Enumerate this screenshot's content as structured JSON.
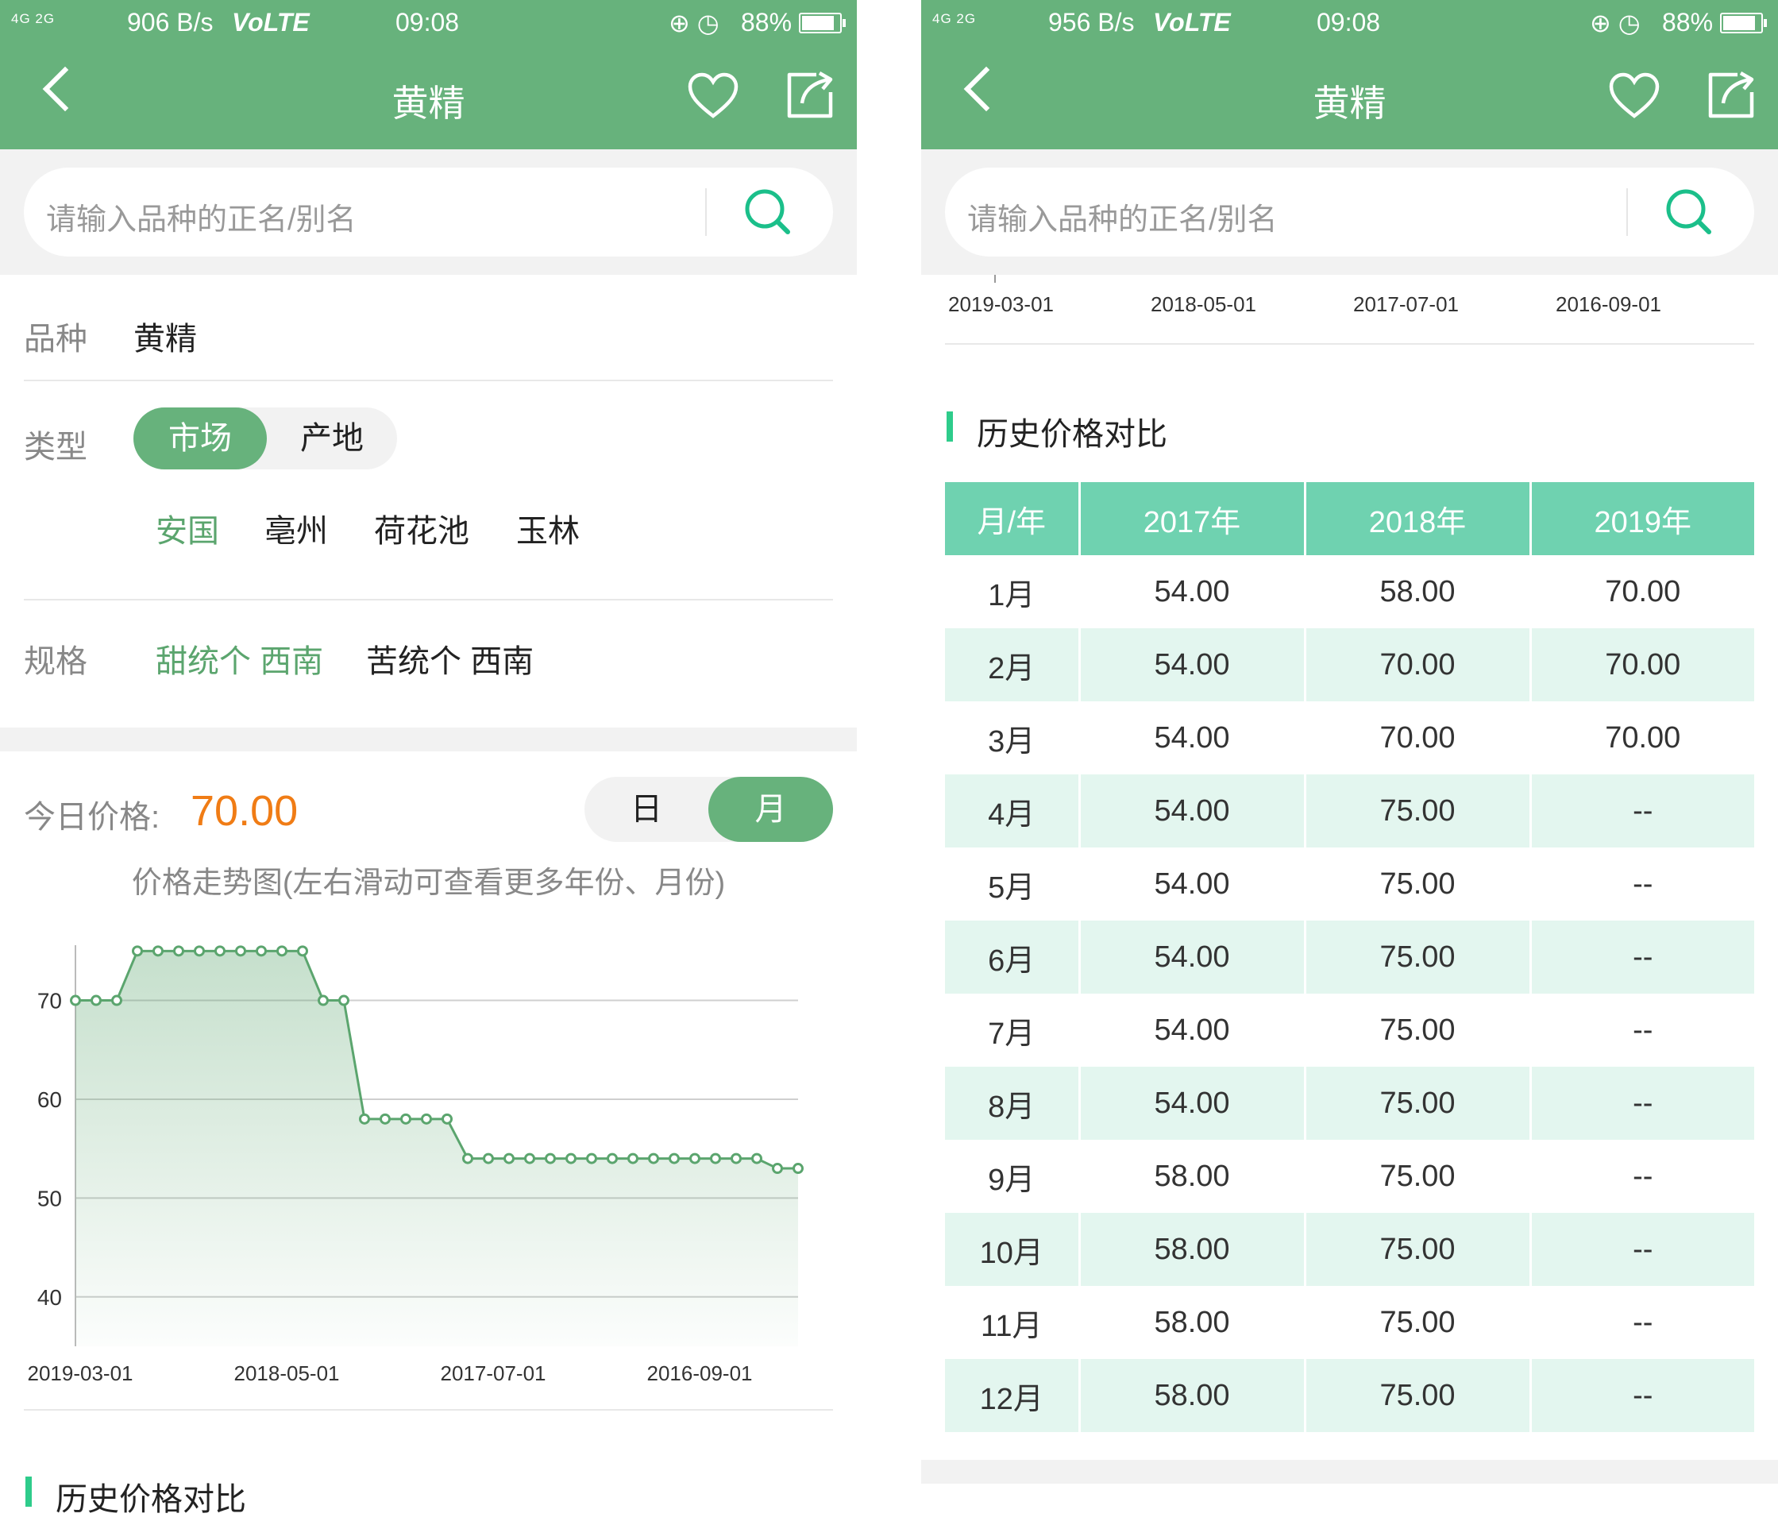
{
  "status_left": {
    "signal": "4G 2G",
    "speed": "906 B/s",
    "volte": "VoLTE",
    "time": "09:08",
    "battery": "88%",
    "battery_level": 0.88
  },
  "status_right": {
    "signal": "4G 2G",
    "speed": "956 B/s",
    "volte": "VoLTE",
    "time": "09:08",
    "battery": "88%",
    "battery_level": 0.88
  },
  "nav": {
    "title": "黄精"
  },
  "search": {
    "placeholder": "请输入品种的正名/别名"
  },
  "labels": {
    "variety": "品种",
    "type": "类型",
    "spec": "规格"
  },
  "variety": "黄精",
  "type_options": [
    "市场",
    "产地"
  ],
  "markets": [
    "安国",
    "亳州",
    "荷花池",
    "玉林"
  ],
  "specs": [
    "甜统个 西南",
    "苦统个 西南"
  ],
  "today": {
    "label": "今日价格:",
    "value": "70.00"
  },
  "period_toggle": [
    "日",
    "月"
  ],
  "trend_title": "价格走势图(左右滑动可查看更多年份、月份)",
  "chart_data": {
    "type": "area",
    "xlabel": "",
    "ylabel": "",
    "ylim": [
      35,
      78
    ],
    "yticks": [
      40,
      50,
      60,
      70
    ],
    "x_tick_labels": [
      "2019-03-01",
      "2018-05-01",
      "2017-07-01",
      "2016-09-01"
    ],
    "x_tick_index": [
      0,
      10,
      20,
      30
    ],
    "values": [
      70,
      70,
      70,
      75,
      75,
      75,
      75,
      75,
      75,
      75,
      75,
      75,
      70,
      70,
      58,
      58,
      58,
      58,
      58,
      54,
      54,
      54,
      54,
      54,
      54,
      54,
      54,
      54,
      54,
      54,
      54,
      54,
      54,
      54,
      53,
      53
    ],
    "color": "#5ba56e",
    "grid": true
  },
  "history": {
    "title": "历史价格对比",
    "columns": [
      "月/年",
      "2017年",
      "2018年",
      "2019年"
    ],
    "rows": [
      [
        "1月",
        "54.00",
        "58.00",
        "70.00"
      ],
      [
        "2月",
        "54.00",
        "70.00",
        "70.00"
      ],
      [
        "3月",
        "54.00",
        "70.00",
        "70.00"
      ],
      [
        "4月",
        "54.00",
        "75.00",
        "--"
      ],
      [
        "5月",
        "54.00",
        "75.00",
        "--"
      ],
      [
        "6月",
        "54.00",
        "75.00",
        "--"
      ],
      [
        "7月",
        "54.00",
        "75.00",
        "--"
      ],
      [
        "8月",
        "54.00",
        "75.00",
        "--"
      ],
      [
        "9月",
        "58.00",
        "75.00",
        "--"
      ],
      [
        "10月",
        "58.00",
        "75.00",
        "--"
      ],
      [
        "11月",
        "58.00",
        "75.00",
        "--"
      ],
      [
        "12月",
        "58.00",
        "75.00",
        "--"
      ]
    ]
  },
  "colors": {
    "brand": "#67b27c",
    "accent": "#f07c15",
    "table_header": "#6fd2b0",
    "table_alt": "#e3f6ef",
    "section_bar": "#2ecc8b"
  },
  "icons": [
    "back-icon",
    "heart-icon",
    "share-icon",
    "search-icon"
  ]
}
